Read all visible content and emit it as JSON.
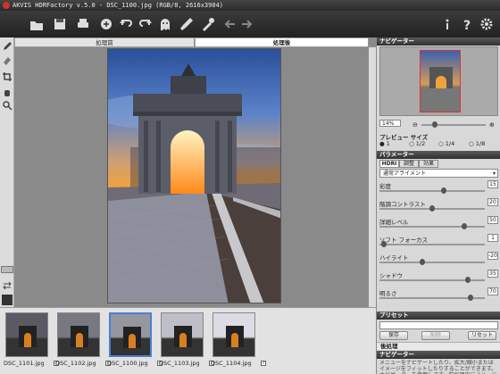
{
  "window": {
    "title": "AKVIS HDRFactory v.5.0 - DSC_1100.jpg (RGB/8, 2616x3904)"
  },
  "toolbar": {
    "icons": [
      "open-icon",
      "save-icon",
      "download-icon",
      "print-icon",
      "share-icon",
      "undo-icon",
      "redo-icon",
      "ghost-icon",
      "brush-icon",
      "eye-dropper-icon",
      "back-arrow-icon",
      "forward-arrow-icon",
      "info-icon",
      "help-icon",
      "settings-icon"
    ]
  },
  "view_tabs": {
    "before": "処理前",
    "after": "処理後"
  },
  "filmstrip": [
    {
      "file": "DSC_1101.jpg",
      "checked": true
    },
    {
      "file": "DSC_1102.jpg",
      "checked": true
    },
    {
      "file": "DSC_1100.jpg",
      "checked": true,
      "selected": true
    },
    {
      "file": "DSC_1103.jpg",
      "checked": true
    },
    {
      "file": "DSC_1104.jpg",
      "checked": true
    }
  ],
  "navigator": {
    "title": "ナビゲーター",
    "zoom": "14%"
  },
  "preview_size": {
    "title": "プレビュー サイズ",
    "options": [
      "1",
      "1/2",
      "1/4",
      "1/8"
    ],
    "selected": "1"
  },
  "params": {
    "title": "パラメーター",
    "tabs": [
      "HDRI",
      "調整",
      "効果"
    ],
    "mode": "通常アライメント",
    "sliders": [
      {
        "label": "彩度",
        "value": "15",
        "pos": 0.62
      },
      {
        "label": "階調コントラスト",
        "value": "20",
        "pos": 0.5
      },
      {
        "label": "詳細レベル",
        "value": "50",
        "pos": 0.82
      },
      {
        "label": "ソフト フォーカス",
        "value": "1",
        "pos": 0.02
      },
      {
        "label": "ハイライト",
        "value": "-20",
        "pos": 0.4
      },
      {
        "label": "シャドウ",
        "value": "35",
        "pos": 0.86
      },
      {
        "label": "明るさ",
        "value": "70",
        "pos": 0.88
      }
    ]
  },
  "presets": {
    "title": "プリセット",
    "save": "保存",
    "delete": "削除",
    "reset": "リセット"
  },
  "post": {
    "title": "後処理"
  },
  "hint": {
    "title": "ナビゲーター",
    "text": "メニューをナビゲートしたり、拡大/縮小またはイメージをフィットしたりすることができます。 ナビゲーターを使用します。前処理中にイメージのピースを表示します。"
  }
}
